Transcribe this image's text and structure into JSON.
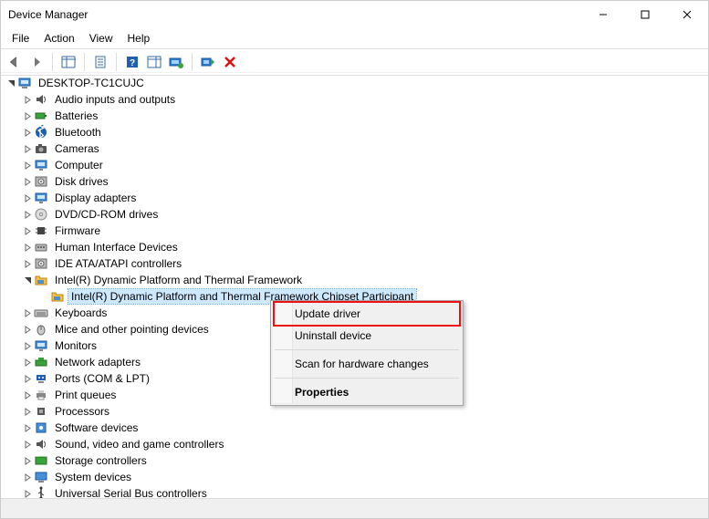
{
  "window": {
    "title": "Device Manager"
  },
  "menu": {
    "file": "File",
    "action": "Action",
    "view": "View",
    "help": "Help"
  },
  "root": {
    "name": "DESKTOP-TC1CUJC"
  },
  "categories": [
    {
      "id": "audio",
      "label": "Audio inputs and outputs",
      "expanded": false,
      "icon": "speaker"
    },
    {
      "id": "batteries",
      "label": "Batteries",
      "expanded": false,
      "icon": "battery"
    },
    {
      "id": "bluetooth",
      "label": "Bluetooth",
      "expanded": false,
      "icon": "bluetooth"
    },
    {
      "id": "cameras",
      "label": "Cameras",
      "expanded": false,
      "icon": "camera"
    },
    {
      "id": "computer",
      "label": "Computer",
      "expanded": false,
      "icon": "monitor"
    },
    {
      "id": "diskdrives",
      "label": "Disk drives",
      "expanded": false,
      "icon": "disk"
    },
    {
      "id": "display",
      "label": "Display adapters",
      "expanded": false,
      "icon": "monitor"
    },
    {
      "id": "dvd",
      "label": "DVD/CD-ROM drives",
      "expanded": false,
      "icon": "cd"
    },
    {
      "id": "firmware",
      "label": "Firmware",
      "expanded": false,
      "icon": "chip"
    },
    {
      "id": "hid",
      "label": "Human Interface Devices",
      "expanded": false,
      "icon": "hid"
    },
    {
      "id": "ide",
      "label": "IDE ATA/ATAPI controllers",
      "expanded": false,
      "icon": "disk"
    },
    {
      "id": "dptf",
      "label": "Intel(R) Dynamic Platform and Thermal Framework",
      "expanded": true,
      "icon": "folder",
      "children": [
        {
          "id": "dptf-part",
          "label": "Intel(R) Dynamic Platform and Thermal Framework Chipset Participant",
          "icon": "folder",
          "selected": true
        }
      ]
    },
    {
      "id": "keyboards",
      "label": "Keyboards",
      "expanded": false,
      "icon": "keyboard"
    },
    {
      "id": "mice",
      "label": "Mice and other pointing devices",
      "expanded": false,
      "icon": "mouse"
    },
    {
      "id": "monitors",
      "label": "Monitors",
      "expanded": false,
      "icon": "monitor"
    },
    {
      "id": "network",
      "label": "Network adapters",
      "expanded": false,
      "icon": "network"
    },
    {
      "id": "ports",
      "label": "Ports (COM & LPT)",
      "expanded": false,
      "icon": "port"
    },
    {
      "id": "print",
      "label": "Print queues",
      "expanded": false,
      "icon": "printer"
    },
    {
      "id": "cpu",
      "label": "Processors",
      "expanded": false,
      "icon": "cpu"
    },
    {
      "id": "software",
      "label": "Software devices",
      "expanded": false,
      "icon": "software"
    },
    {
      "id": "sound",
      "label": "Sound, video and game controllers",
      "expanded": false,
      "icon": "speaker"
    },
    {
      "id": "storage",
      "label": "Storage controllers",
      "expanded": false,
      "icon": "storage"
    },
    {
      "id": "system",
      "label": "System devices",
      "expanded": false,
      "icon": "system"
    },
    {
      "id": "usb",
      "label": "Universal Serial Bus controllers",
      "expanded": false,
      "icon": "usb"
    }
  ],
  "context_menu": {
    "update": "Update driver",
    "uninstall": "Uninstall device",
    "scan": "Scan for hardware changes",
    "properties": "Properties",
    "highlighted": "update"
  }
}
